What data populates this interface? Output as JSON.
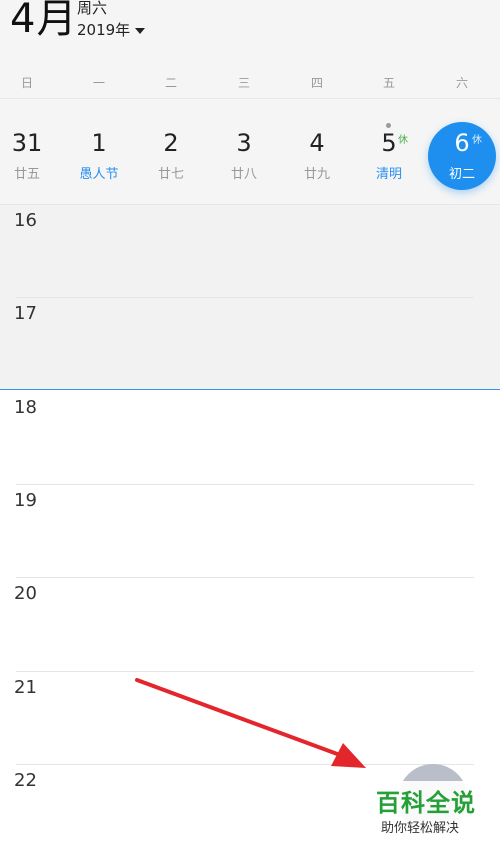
{
  "header": {
    "month": "4月",
    "weekday": "周六",
    "year": "2019年"
  },
  "week_headers": [
    "日",
    "一",
    "二",
    "三",
    "四",
    "五",
    "六"
  ],
  "days": [
    {
      "num": "31",
      "lunar": "廿五",
      "lunar_highlight": false
    },
    {
      "num": "1",
      "lunar": "愚人节",
      "lunar_highlight": true
    },
    {
      "num": "2",
      "lunar": "廿七",
      "lunar_highlight": false
    },
    {
      "num": "3",
      "lunar": "廿八",
      "lunar_highlight": false
    },
    {
      "num": "4",
      "lunar": "廿九",
      "lunar_highlight": false
    },
    {
      "num": "5",
      "lunar": "清明",
      "lunar_highlight": true,
      "badge": "休"
    },
    {
      "num": "6",
      "lunar": "初二",
      "lunar_highlight": false,
      "badge": "休",
      "selected": true
    }
  ],
  "hours": [
    "16",
    "17",
    "18",
    "19",
    "20",
    "21",
    "22"
  ],
  "watermark": {
    "title": "百科全说",
    "subtitle": "助你轻松解决"
  },
  "colors": {
    "accent": "#1e8fef",
    "holiday_text": "#2a8ef0",
    "rest_badge": "#4cae4c",
    "arrow": "#e3262b",
    "watermark": "#24a036"
  }
}
